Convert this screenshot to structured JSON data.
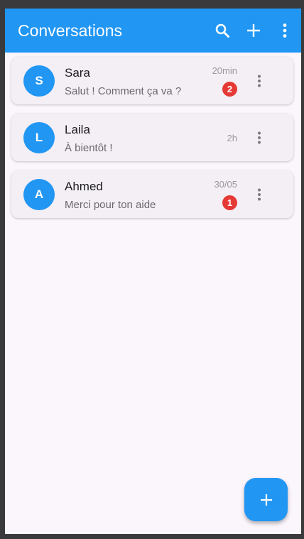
{
  "appbar": {
    "title": "Conversations",
    "actions": [
      "search-icon",
      "add-icon",
      "more-vert-icon"
    ]
  },
  "colors": {
    "primary": "#2196f3",
    "badge": "#e53935",
    "background": "#fbf5fc",
    "card": "#f4eff5"
  },
  "conversations": [
    {
      "initial": "S",
      "name": "Sara",
      "message": "Salut ! Comment ça va ?",
      "time": "20min",
      "unread": "2"
    },
    {
      "initial": "L",
      "name": "Laila",
      "message": "À bientôt !",
      "time": "2h",
      "unread": null
    },
    {
      "initial": "A",
      "name": "Ahmed",
      "message": "Merci pour ton aide",
      "time": "30/05",
      "unread": "1"
    }
  ],
  "fab": {
    "icon": "add-icon"
  }
}
